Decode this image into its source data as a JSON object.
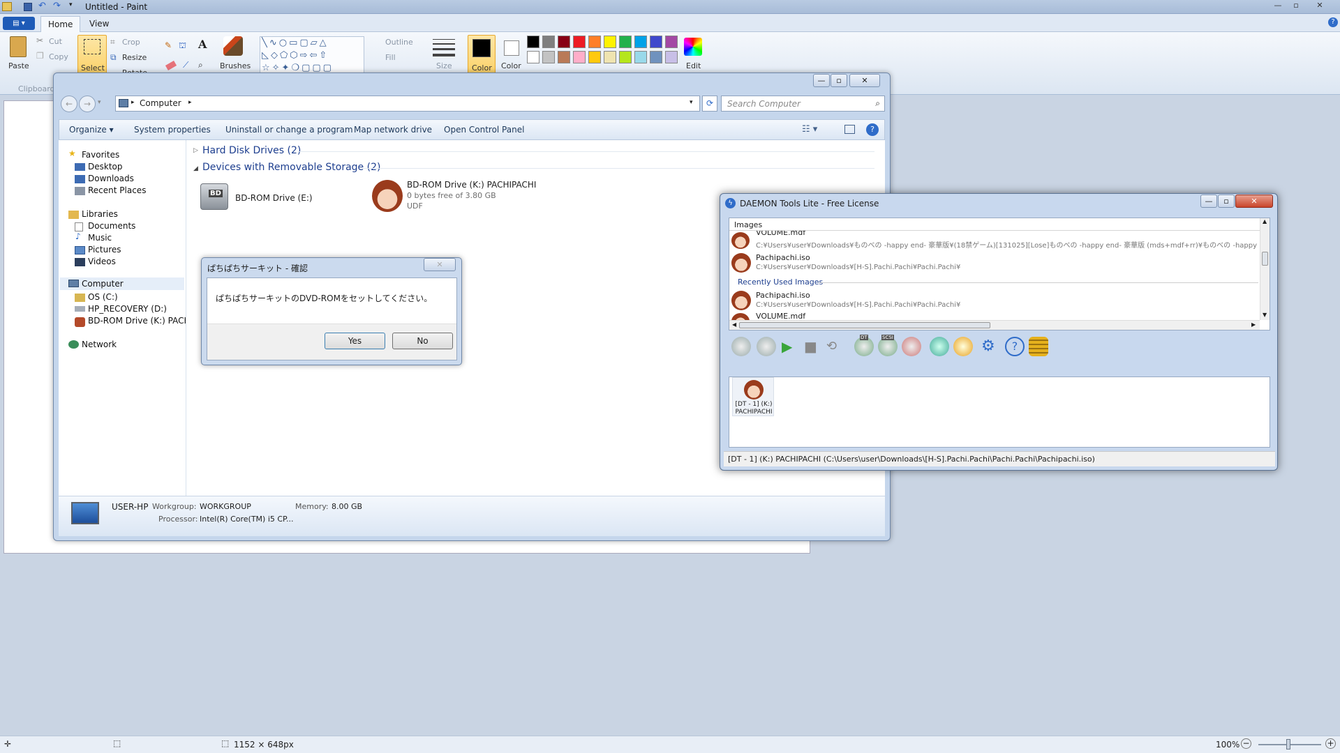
{
  "paint": {
    "title": "Untitled - Paint",
    "tabs": {
      "home": "Home",
      "view": "View"
    },
    "clipboard": {
      "paste": "Paste",
      "cut": "Cut",
      "copy": "Copy",
      "group": "Clipboard"
    },
    "image": {
      "select": "Select",
      "crop": "Crop",
      "resize": "Resize",
      "rotate": "Rotate"
    },
    "tools": {
      "brushes": "Brushes"
    },
    "shapes": {
      "outline": "Outline",
      "fill": "Fill"
    },
    "size": "Size",
    "color1": "Color",
    "color2": "Color",
    "edit_colors": "Edit",
    "palette": [
      "#000000",
      "#7f7f7f",
      "#880015",
      "#ed1c24",
      "#ff7f27",
      "#fff200",
      "#22b14c",
      "#00a2e8",
      "#3f48cc",
      "#a349a4",
      "#ffffff",
      "#c3c3c3",
      "#b97a57",
      "#ffaec9",
      "#ffc90e",
      "#efe4b0",
      "#b5e61d",
      "#99d9ea",
      "#7092be",
      "#c8bfe7"
    ],
    "status": {
      "dimensions": "1152 × 648px",
      "zoom": "100%"
    }
  },
  "explorer": {
    "address": "Computer",
    "search_placeholder": "Search Computer",
    "commands": {
      "organize": "Organize",
      "system": "System properties",
      "uninstall": "Uninstall or change a program",
      "map": "Map network drive",
      "control": "Open Control Panel"
    },
    "nav": {
      "favorites": "Favorites",
      "desktop": "Desktop",
      "downloads": "Downloads",
      "recent": "Recent Places",
      "libraries": "Libraries",
      "documents": "Documents",
      "music": "Music",
      "pictures": "Pictures",
      "videos": "Videos",
      "computer": "Computer",
      "os": "OS (C:)",
      "recovery": "HP_RECOVERY (D:)",
      "bdrom": "BD-ROM Drive (K:) PACH",
      "network": "Network"
    },
    "groups": {
      "hdd": "Hard Disk Drives (2)",
      "removable": "Devices with Removable Storage (2)"
    },
    "drives": {
      "e_name": "BD-ROM Drive (E:)",
      "k_name": "BD-ROM Drive (K:) PACHIPACHI",
      "k_free": "0 bytes free of 3.80 GB",
      "k_fs": "UDF",
      "bd_label": "BD"
    },
    "details": {
      "name": "USER-HP",
      "workgroup_label": "Workgroup:",
      "workgroup": "WORKGROUP",
      "memory_label": "Memory:",
      "memory": "8.00 GB",
      "processor_label": "Processor:",
      "processor": "Intel(R) Core(TM) i5 CP..."
    }
  },
  "confirm": {
    "title": "ぱちぱちサーキット - 確認",
    "message": "ぱちぱちサーキットのDVD-ROMをセットしてください。",
    "yes": "Yes",
    "no": "No"
  },
  "daemon": {
    "title": "DAEMON Tools Lite - Free License",
    "images_header": "Images",
    "items": [
      {
        "name": "VOLUME.mdf",
        "path": "C:¥Users¥user¥Downloads¥ものべの -happy end- 豪華版¥(18禁ゲーム)[131025][Lose]ものべの -happy end- 豪華版 (mds+mdf+rr)¥ものべの -happy end-"
      },
      {
        "name": "Pachipachi.iso",
        "path": "C:¥Users¥user¥Downloads¥[H-S].Pachi.Pachi¥Pachi.Pachi¥"
      }
    ],
    "recent_header": "Recently Used Images",
    "recent": [
      {
        "name": "Pachipachi.iso",
        "path": "C:¥Users¥user¥Downloads¥[H-S].Pachi.Pachi¥Pachi.Pachi¥"
      },
      {
        "name": "VOLUME.mdf",
        "path": ""
      }
    ],
    "tool_badges": {
      "dt": "DT",
      "scsi": "SCSI"
    },
    "drive_label": "[DT - 1] (K:) PACHIPACHI",
    "drive_line1": "[DT - 1] (K:)",
    "drive_line2": "PACHIPACHI",
    "status": "[DT - 1] (K:) PACHIPACHI (C:\\Users\\user\\Downloads\\[H-S].Pachi.Pachi\\Pachi.Pachi\\Pachipachi.iso)"
  },
  "colors": {
    "paint_accent": "#1e5bb7",
    "explorer_blue": "#1e3f8f",
    "selection": "#fbd26a"
  }
}
